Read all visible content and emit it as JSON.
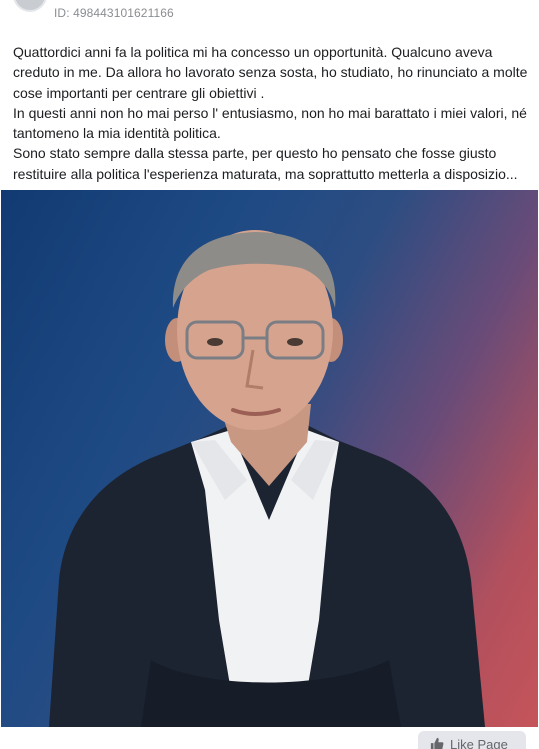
{
  "post": {
    "page_id": "ID: 498443101621166",
    "text_lines": [
      "Quattordici anni fa la politica mi ha concesso un opportunità. Qualcuno aveva creduto in me. Da allora ho lavorato senza sosta, ho studiato, ho rinunciato a molte cose importanti per centrare gli obiettivi .",
      "In questi anni non ho mai perso l' entusiasmo, non ho mai barattato i miei valori, né tantomeno la mia identità politica.",
      "Sono stato sempre dalla stessa parte, per questo ho pensato che fosse giusto restituire alla politica l'esperienza maturata, ma soprattutto metterla a disposizio..."
    ]
  },
  "footer": {
    "like_page_label": "Like Page",
    "like_icon": "thumbs-up-icon"
  },
  "colors": {
    "gradient_blue": "#1e4a84",
    "gradient_red": "#c5545a",
    "text": "#1c1e21",
    "muted": "#8a8d91"
  }
}
